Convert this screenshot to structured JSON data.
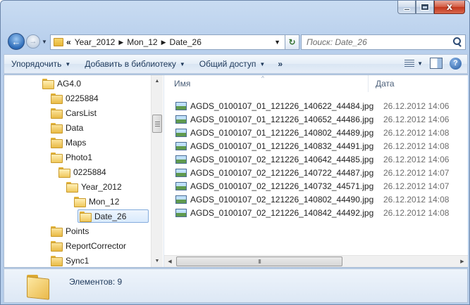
{
  "window": {
    "caption_buttons": {
      "minimize_icon": "minimize-icon",
      "maximize_icon": "maximize-icon",
      "close_glyph": "x"
    }
  },
  "nav": {
    "back_glyph": "←",
    "forward_glyph": "→",
    "history_glyph": "▼",
    "breadcrumb_prefix": "«",
    "breadcrumbs": [
      "Year_2012",
      "Mon_12",
      "Date_26"
    ],
    "crumb_separator": "▶",
    "address_dropdown": "▼",
    "refresh_glyph": "↻",
    "search_placeholder": "Поиск: Date_26"
  },
  "toolbar": {
    "organize": "Упорядочить",
    "add_to_library": "Добавить в библиотеку",
    "share": "Общий доступ",
    "more": "»",
    "dropdown_glyph": "▼",
    "help_glyph": "?"
  },
  "tree": {
    "items": [
      {
        "label": "AG4.0",
        "level": 0
      },
      {
        "label": "0225884",
        "level": 1
      },
      {
        "label": "CarsList",
        "level": 1
      },
      {
        "label": "Data",
        "level": 1
      },
      {
        "label": "Maps",
        "level": 1
      },
      {
        "label": "Photo1",
        "level": 1
      },
      {
        "label": "0225884",
        "level": 2
      },
      {
        "label": "Year_2012",
        "level": 3
      },
      {
        "label": "Mon_12",
        "level": 4
      },
      {
        "label": "Date_26",
        "level": 5,
        "selected": true
      },
      {
        "label": "Points",
        "level": 1
      },
      {
        "label": "ReportCorrector",
        "level": 1
      },
      {
        "label": "Sync1",
        "level": 1
      }
    ],
    "scroll_up": "▲",
    "scroll_down": "▼"
  },
  "files": {
    "columns": {
      "name": "Имя",
      "date": "Дата"
    },
    "sort_glyph": "^",
    "rows": [
      {
        "name": "AGDS_0100107_01_121226_140622_44484.jpg",
        "date": "26.12.2012 14:06"
      },
      {
        "name": "AGDS_0100107_01_121226_140652_44486.jpg",
        "date": "26.12.2012 14:06"
      },
      {
        "name": "AGDS_0100107_01_121226_140802_44489.jpg",
        "date": "26.12.2012 14:08"
      },
      {
        "name": "AGDS_0100107_01_121226_140832_44491.jpg",
        "date": "26.12.2012 14:08"
      },
      {
        "name": "AGDS_0100107_02_121226_140642_44485.jpg",
        "date": "26.12.2012 14:06"
      },
      {
        "name": "AGDS_0100107_02_121226_140722_44487.jpg",
        "date": "26.12.2012 14:07"
      },
      {
        "name": "AGDS_0100107_02_121226_140732_44571.jpg",
        "date": "26.12.2012 14:07"
      },
      {
        "name": "AGDS_0100107_02_121226_140802_44490.jpg",
        "date": "26.12.2012 14:08"
      },
      {
        "name": "AGDS_0100107_02_121226_140842_44492.jpg",
        "date": "26.12.2012 14:08"
      }
    ],
    "hscroll_left": "◀",
    "hscroll_right": "▶",
    "thumb_grip": "III"
  },
  "details": {
    "items_count": "Элементов: 9"
  }
}
